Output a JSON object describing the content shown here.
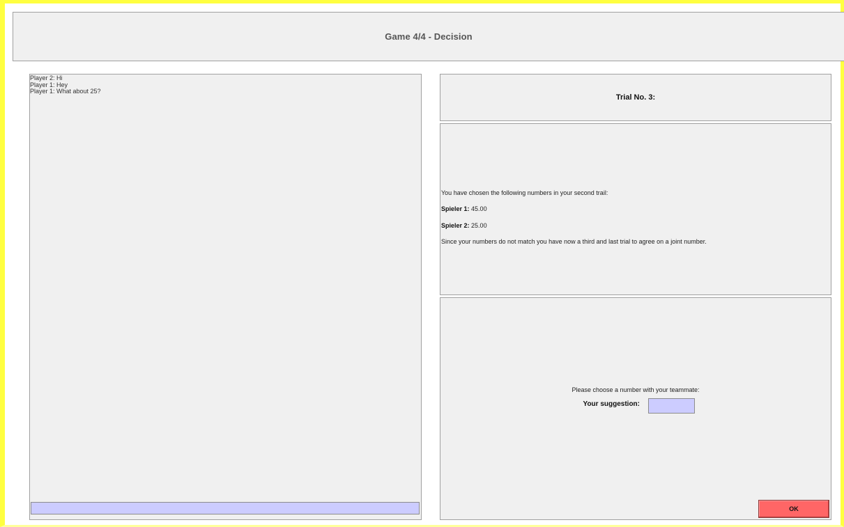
{
  "header": {
    "title": "Game 4/4 - Decision"
  },
  "chat": {
    "messages": [
      "Player 2: Hi",
      "Player 1: Hey",
      "Player 1: What about 25?"
    ],
    "input_value": ""
  },
  "trial": {
    "title": "Trial No. 3:"
  },
  "info": {
    "intro": "You have chosen the following numbers in your second trail:",
    "player1_label": "Spieler 1:",
    "player1_value": "45.00",
    "player2_label": "Spieler 2:",
    "player2_value": "25.00",
    "note": "Since your numbers do not match you have now a third and last trial to agree on a joint number."
  },
  "decision": {
    "prompt": "Please choose a number with your teammate:",
    "suggestion_label": "Your suggestion:",
    "suggestion_value": "",
    "ok_label": "OK"
  },
  "colors": {
    "frame_border": "#ffff40",
    "panel_background": "#f0f0f0",
    "input_background": "#ccccff",
    "ok_button": "#ff6666"
  }
}
